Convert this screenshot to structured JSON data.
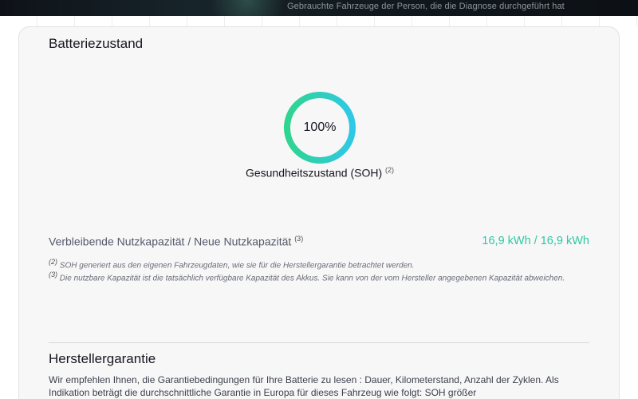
{
  "banner": {
    "text": "Gebrauchte Fahrzeuge der Person, die die Diagnose durchgeführt hat"
  },
  "battery_section": {
    "title": "Batteriezustand",
    "soh": {
      "value_text": "100%",
      "percent": 100,
      "label": "Gesundheitszustand (SOH)",
      "footnote_ref": "(2)"
    },
    "capacity": {
      "label": "Verbleibende Nutzkapazität / Neue Nutzkapazität",
      "footnote_ref": "(3)",
      "value": "16,9 kWh / 16,9 kWh"
    },
    "footnotes": [
      {
        "ref": "(2)",
        "text": "SOH generiert aus den eigenen Fahrzeugdaten, wie sie für die Herstellergarantie betrachtet werden."
      },
      {
        "ref": "(3)",
        "text": "Die nutzbare Kapazität ist die tatsächlich verfügbare Kapazität des Akkus. Sie kann von der vom Hersteller angegebenen Kapazität abweichen."
      }
    ]
  },
  "warranty_section": {
    "title": "Herstellergarantie",
    "text": "Wir empfehlen Ihnen, die Garantiebedingungen für Ihre Batterie zu lesen : Dauer, Kilometerstand, Anzahl der Zyklen. Als Indikation beträgt die durchschnittliche Garantie in Europa für dieses Fahrzeug wie folgt: SOH größer"
  },
  "colors": {
    "gauge_start": "#2fd58e",
    "gauge_end": "#2fc8e6",
    "capacity_value": "#2fc9a0"
  }
}
